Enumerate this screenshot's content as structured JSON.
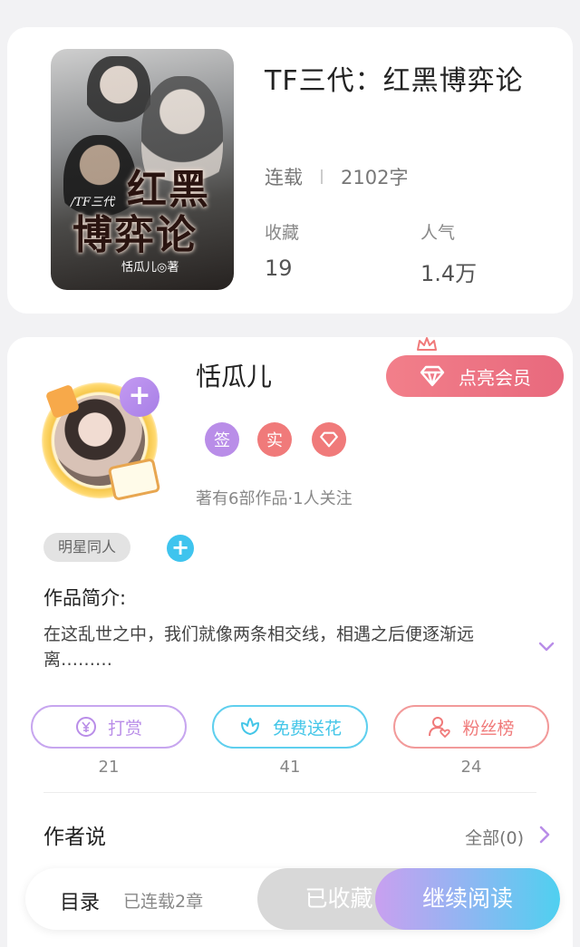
{
  "book": {
    "cover": {
      "title_line1": "红黑",
      "title_line2": "博弈论",
      "tag": "/TF三代",
      "author": "恬瓜儿◎著"
    },
    "title": "TF三代：红黑博弈论",
    "status": "连载",
    "word_count": "2102字",
    "stats": [
      {
        "label": "收藏",
        "value": "19"
      },
      {
        "label": "人气",
        "value": "1.4万"
      }
    ]
  },
  "author": {
    "name": "恬瓜儿",
    "vip_button": "点亮会员",
    "badges": [
      {
        "text": "签",
        "color": "#b98de8"
      },
      {
        "text": "实",
        "color": "#f07a7a"
      },
      {
        "icon": "diamond-icon",
        "color": "#f07a7a"
      }
    ],
    "meta": "著有6部作品·1人关注",
    "follow_plus": "+"
  },
  "tags": {
    "chip": "明星同人",
    "add": "+"
  },
  "intro": {
    "title": "作品简介:",
    "text": "在这乱世之中，我们就像两条相交线，相遇之后便逐渐远离………"
  },
  "actions": [
    {
      "label": "打赏",
      "count": "21",
      "color": "#b98de8",
      "icon": "yuan-icon"
    },
    {
      "label": "免费送花",
      "count": "41",
      "color": "#43c6e8",
      "icon": "flower-icon"
    },
    {
      "label": "粉丝榜",
      "count": "24",
      "color": "#f07a7a",
      "icon": "fan-icon"
    }
  ],
  "author_says": {
    "title": "作者说",
    "all": "全部(0)"
  },
  "bottom_bar": {
    "toc": "目录",
    "toc_sub": "已连载2章",
    "favorited": "已收藏",
    "continue": "继续阅读"
  }
}
